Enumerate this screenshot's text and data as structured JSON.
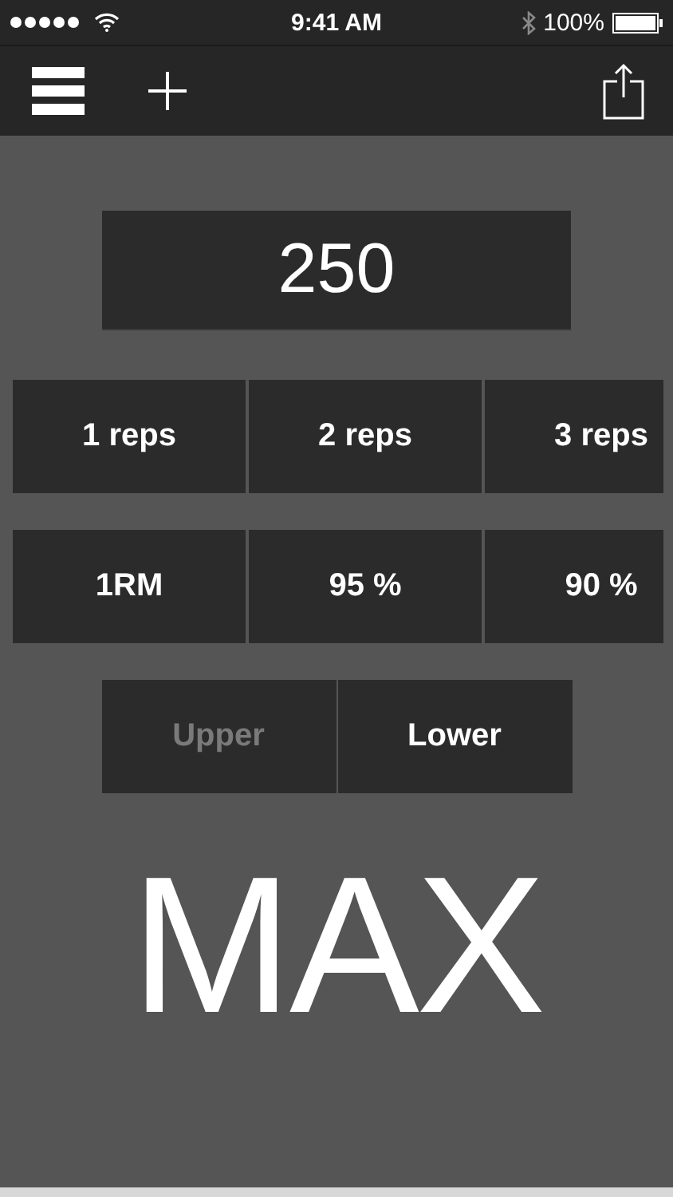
{
  "status_bar": {
    "time": "9:41 AM",
    "battery": "100%"
  },
  "display": {
    "value": "250"
  },
  "reps": [
    "1 reps",
    "2 reps",
    "3 reps"
  ],
  "percents": [
    "1RM",
    "95 %",
    "90 %"
  ],
  "bounds": [
    {
      "label": "Upper",
      "selected": false
    },
    {
      "label": "Lower",
      "selected": true
    }
  ],
  "result": "MAX"
}
